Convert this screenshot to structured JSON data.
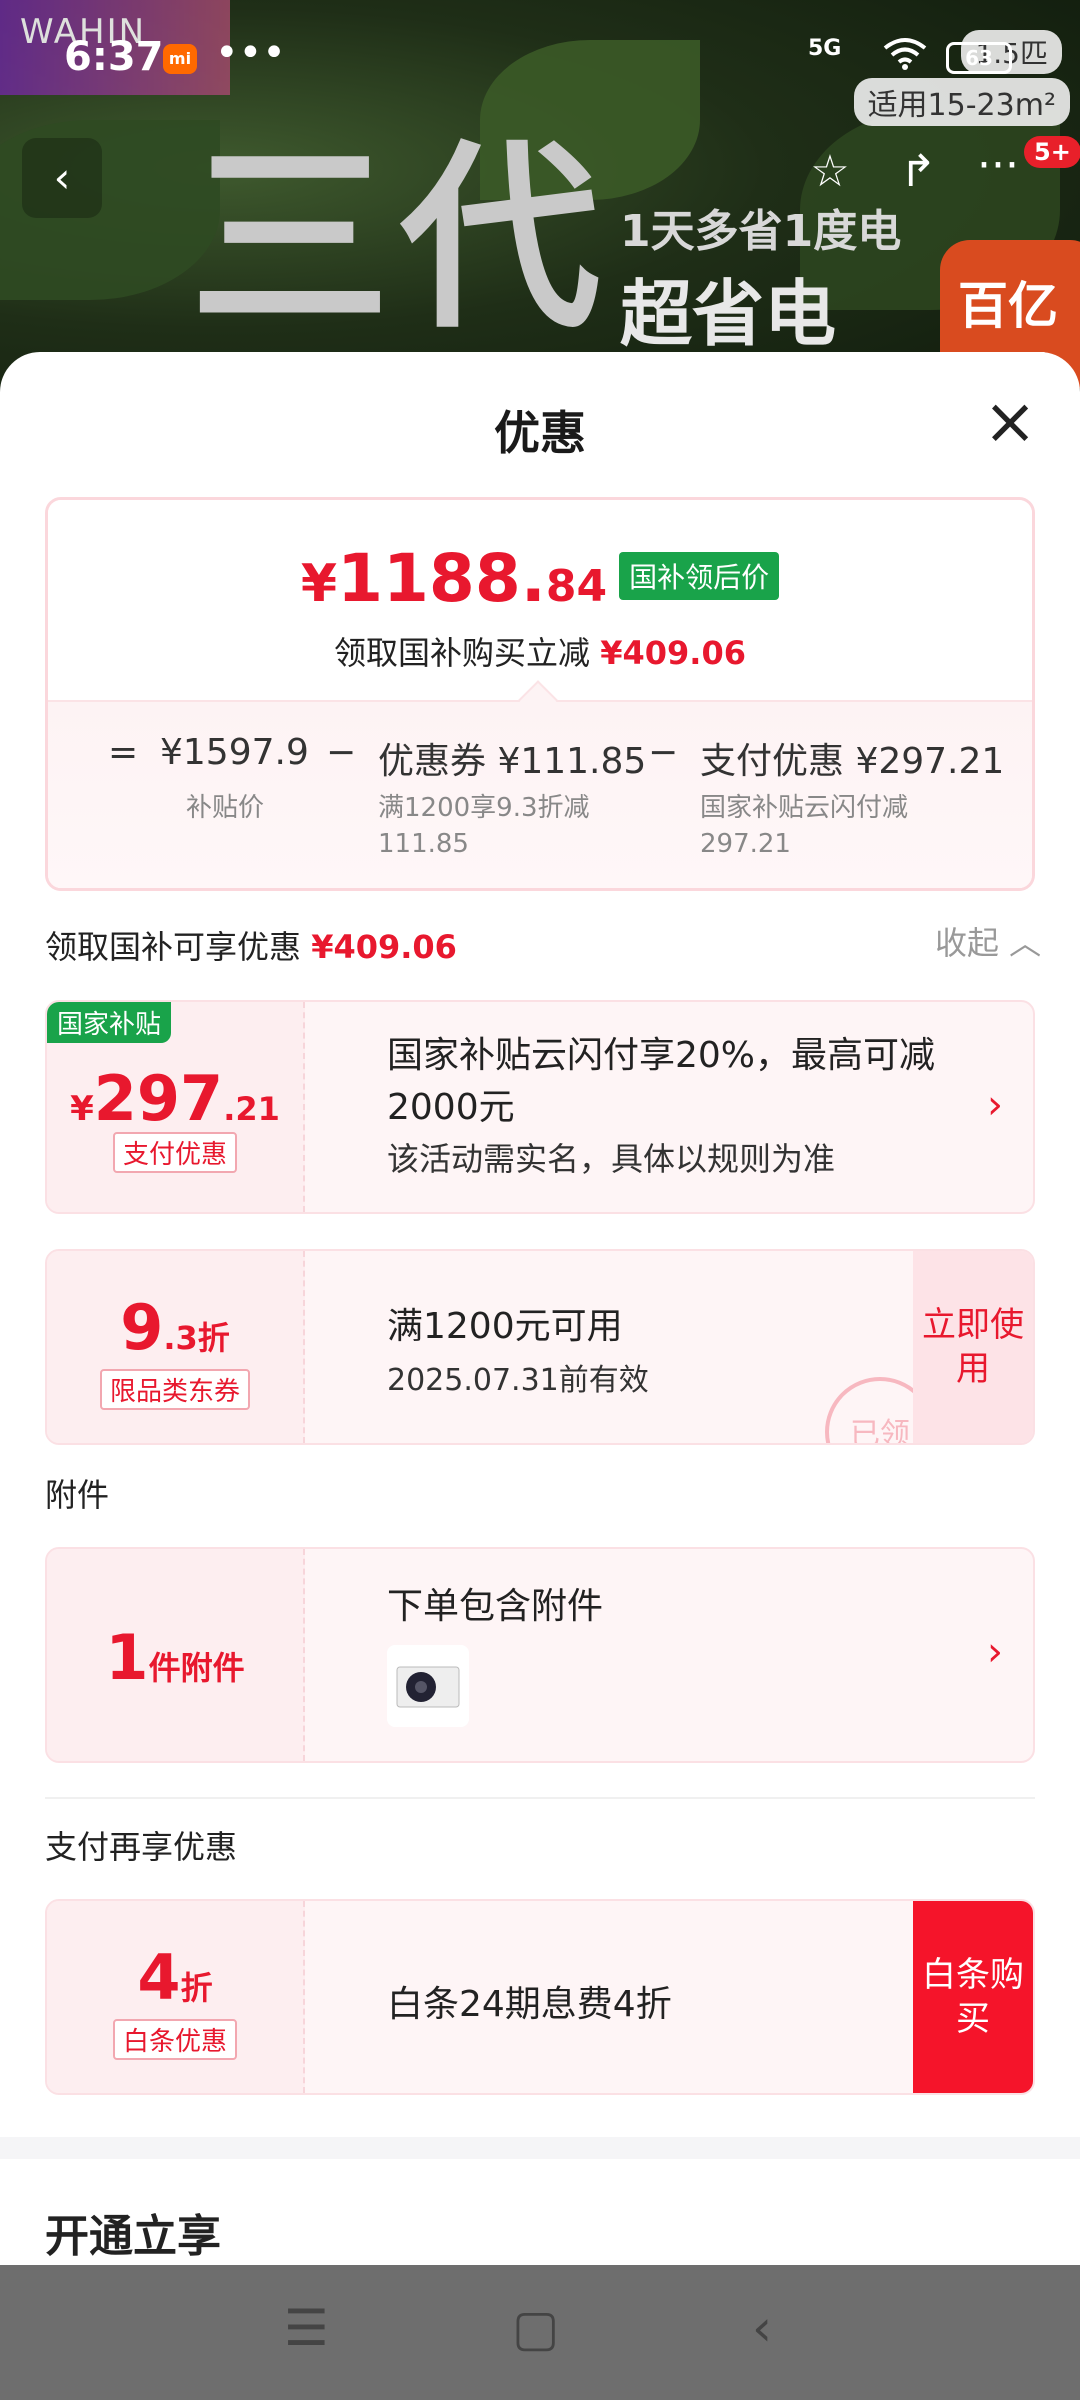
{
  "status_bar": {
    "time": "6:37",
    "app_badge": "mi",
    "more": "•••",
    "network": "5G",
    "battery": "63"
  },
  "banner": {
    "brand": "WAHIN",
    "big_text": "三代",
    "sub1": "1天多省1度电",
    "sub2": "超省电",
    "tag_power": "1.5匹",
    "tag_area": "适用15-23m²",
    "sticker": "百亿补贴",
    "cart_badge": "5+"
  },
  "sheet": {
    "title": "优惠",
    "summary": {
      "yen": "¥",
      "price_int": "1188.",
      "price_dec": "84",
      "price_tag": "国补领后价",
      "sub_text": "领取国补购买立减",
      "sub_amount": "¥409.06",
      "eq": "=",
      "base_price": "¥1597.9",
      "base_label": "补贴价",
      "minus1": "−",
      "coupon_text": "优惠券 ¥111.85",
      "coupon_sub1": "满1200享9.3折减",
      "coupon_sub2": "111.85",
      "minus2": "−",
      "pay_text": "支付优惠 ¥297.21",
      "pay_sub1": "国家补贴云闪付减",
      "pay_sub2": "297.21"
    },
    "subsidy_section": {
      "label": "领取国补可享优惠",
      "amount": "¥409.06",
      "collapse": "收起 ︿"
    },
    "card_guo": {
      "badge": "国家补贴",
      "yen": "¥",
      "int": "297",
      "dec": ".21",
      "tag": "支付优惠",
      "title": "国家补贴云闪付享20%，最高可减2000元",
      "desc": "该活动需实名，具体以规则为准",
      "chev": "›"
    },
    "card_coupon": {
      "int": "9",
      "dec": ".3折",
      "tag": "限品类东券",
      "title": "满1200元可用",
      "desc": "2025.07.31前有效",
      "action": "立即使用",
      "stamp": "已领"
    },
    "accessory_section": {
      "label": "附件"
    },
    "card_accessory": {
      "int": "1",
      "unit": "件附件",
      "title": "下单包含附件",
      "chev": "›"
    },
    "pay_section": {
      "label": "支付再享优惠"
    },
    "card_baitiao": {
      "int": "4",
      "unit": "折",
      "tag": "白条优惠",
      "title": "白条24期息费4折",
      "action": "白条购买"
    },
    "open_section": {
      "label": "开通立享"
    }
  },
  "system_nav": {
    "menu": "☰",
    "home": "▢",
    "back": "‹"
  }
}
